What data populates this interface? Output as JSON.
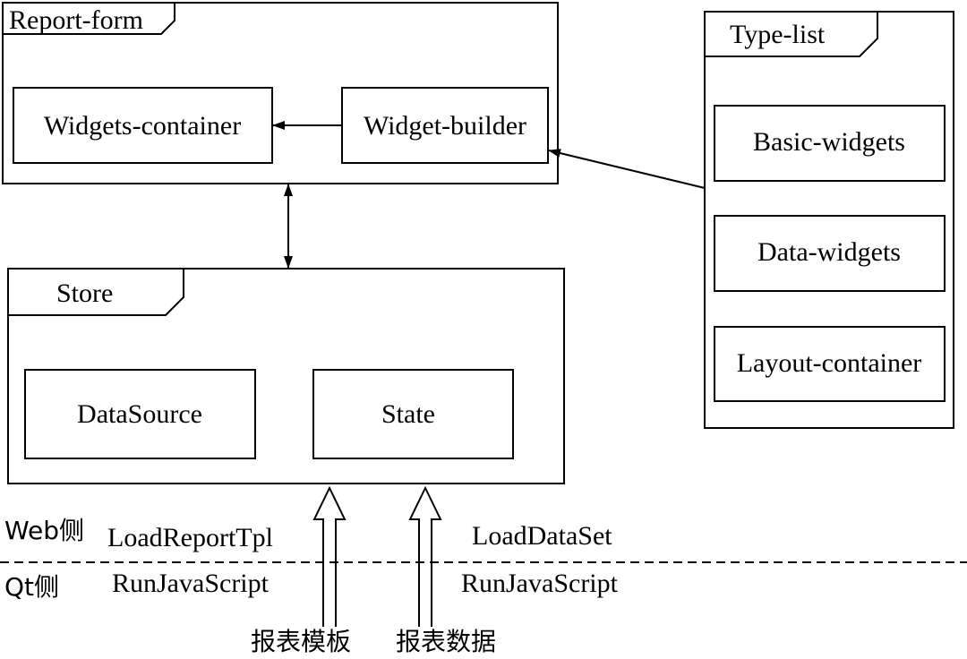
{
  "frames": {
    "report_form": {
      "title": "Report-form",
      "widgets_container": "Widgets-container",
      "widget_builder": "Widget-builder"
    },
    "type_list": {
      "title": "Type-list",
      "items": [
        "Basic-widgets",
        "Data-widgets",
        "Layout-container"
      ]
    },
    "store": {
      "title": "Store",
      "data_source": "DataSource",
      "state": "State"
    }
  },
  "boundary": {
    "web_side": "Web侧",
    "qt_side": "Qt侧",
    "load_report_tpl": "LoadReportTpl",
    "load_data_set": "LoadDataSet",
    "run_js_left": "RunJavaScript",
    "run_js_right": "RunJavaScript",
    "report_template": "报表模板",
    "report_data": "报表数据"
  }
}
